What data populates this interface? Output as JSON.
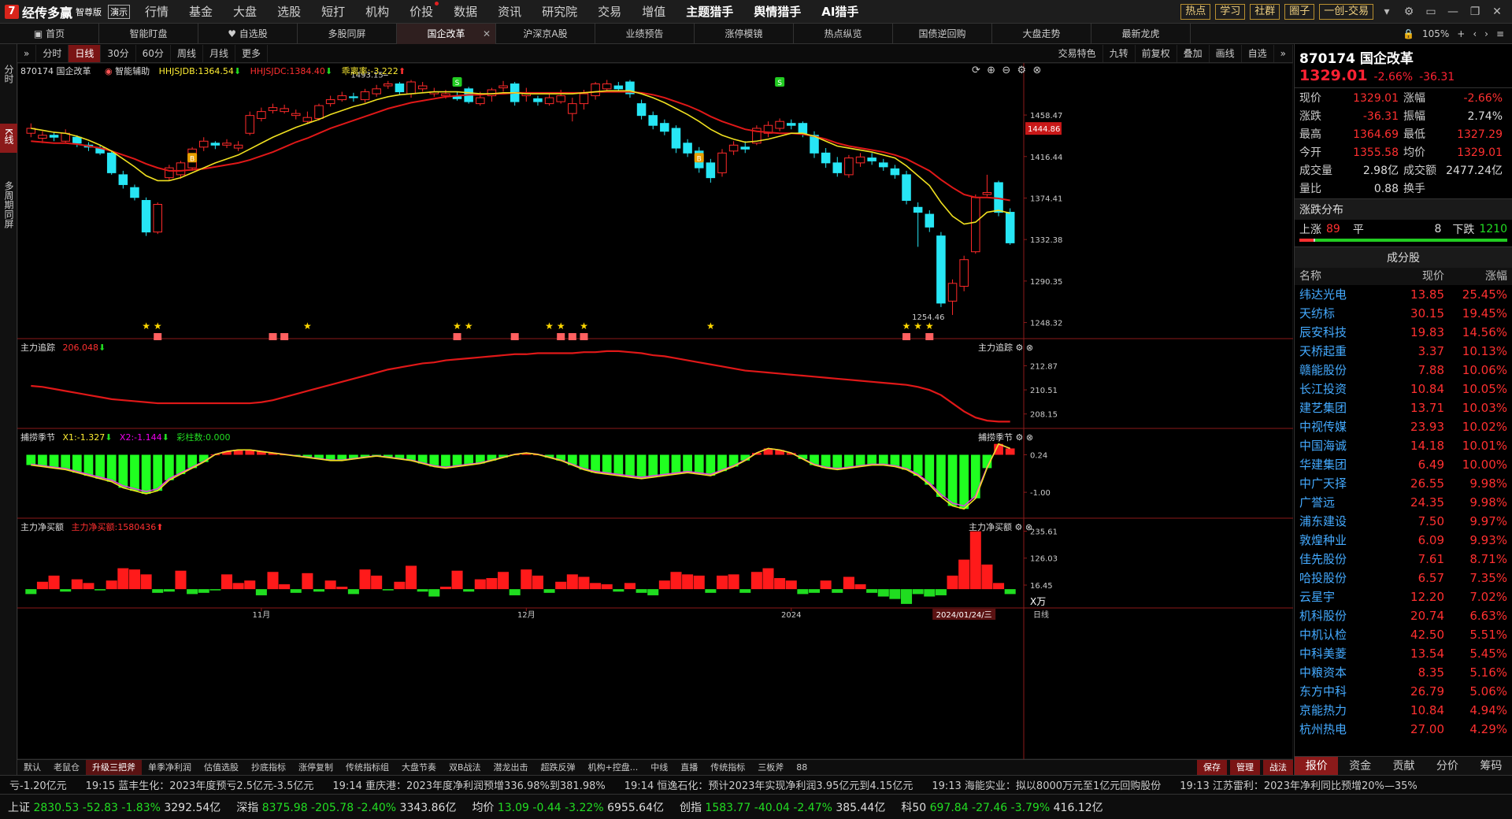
{
  "app": {
    "logo_mark": "7",
    "name": "经传多赢",
    "edition": "智尊版",
    "demo": "演示"
  },
  "menu": [
    "行情",
    "基金",
    "大盘",
    "选股",
    "短打",
    "机构",
    "价投",
    "数据",
    "资讯",
    "研究院",
    "交易",
    "增值",
    "主题猎手",
    "舆情猎手",
    "AI猎手"
  ],
  "menu_hot": [
    "主题猎手",
    "舆情猎手",
    "AI猎手"
  ],
  "menu_dot": [
    "价投"
  ],
  "top_buttons": [
    "热点",
    "学习",
    "社群",
    "圈子",
    "一创-交易"
  ],
  "tabs": [
    "首页",
    "智能盯盘",
    "自选股",
    "多股同屏",
    "国企改革",
    "沪深京A股",
    "业绩预告",
    "涨停模镜",
    "热点纵览",
    "国债逆回购",
    "大盘走势",
    "最新龙虎"
  ],
  "active_tab": "国企改革",
  "tabs_right": {
    "zoom": "105%"
  },
  "left_tabs": [
    "分时",
    "K线",
    "多周期同屏"
  ],
  "chart_bar": {
    "items": [
      "分时",
      "日线",
      "30分",
      "60分",
      "周线",
      "月线",
      "更多"
    ],
    "active": "日线",
    "right": [
      "交易特色",
      "九转",
      "前复权",
      "叠加",
      "画线",
      "自选"
    ]
  },
  "main_header": {
    "code_name": "870174 国企改革",
    "assist": "智能辅助",
    "hhjsjdb": "HHJSJDB:1364.54",
    "hhjsjdc": "HHJSJDC:1384.40",
    "ratio": "乖离率:-3.222"
  },
  "price_labels": [
    "1458.47",
    "1416.44",
    "1374.41",
    "1332.38",
    "1290.35",
    "1248.32"
  ],
  "current_price_tag": "1444.86",
  "high_label": "1493.15",
  "low_label": "1254.46",
  "panel2": {
    "title": "主力追踪",
    "value": "206.048",
    "right": "主力追踪",
    "labels": [
      "212.87",
      "210.51",
      "208.15"
    ]
  },
  "panel3": {
    "title": "捕捞季节",
    "x1": "X1:-1.327",
    "x2": "X2:-1.144",
    "bars": "彩柱数:0.000",
    "right": "捕捞季节",
    "labels": [
      "0.24",
      "-1.00"
    ]
  },
  "panel4": {
    "title": "主力净买额",
    "value": "主力净买额:1580436",
    "right": "主力净买额",
    "labels": [
      "235.61",
      "126.03",
      "16.45"
    ],
    "unit": "X万"
  },
  "date_axis": [
    "11月",
    "12月",
    "2024",
    "2024/01/24/三"
  ],
  "period_label": "日线",
  "bottom_tabs": [
    "默认",
    "老鼠仓",
    "升级三把斧",
    "单季净利润",
    "估值选股",
    "抄底指标",
    "涨停复制",
    "传统指标组",
    "大盘节奏",
    "双B战法",
    "潜龙出击",
    "超跌反弹",
    "机构+控盘...",
    "中线",
    "直播",
    "传统指标",
    "三板斧",
    "88"
  ],
  "bottom_active": "升级三把斧",
  "bottom_right": [
    "保存",
    "管理",
    "战法"
  ],
  "quote": {
    "code": "870174 国企改革",
    "price": "1329.01",
    "pct": "-2.66%",
    "chg": "-36.31",
    "rows": [
      [
        "现价",
        "1329.01",
        "涨幅",
        "-2.66%"
      ],
      [
        "涨跌",
        "-36.31",
        "振幅",
        "2.74%"
      ],
      [
        "最高",
        "1364.69",
        "最低",
        "1327.29"
      ],
      [
        "今开",
        "1355.58",
        "均价",
        "1329.01"
      ],
      [
        "成交量",
        "2.98亿",
        "成交额",
        "2477.24亿"
      ],
      [
        "量比",
        "0.88",
        "换手",
        ""
      ]
    ]
  },
  "dist": {
    "title": "涨跌分布",
    "up_label": "上涨",
    "up": "89",
    "flat_label": "平",
    "flat": "8",
    "down_label": "下跌",
    "down": "1210"
  },
  "constituents": {
    "title": "成分股",
    "headers": [
      "名称",
      "现价",
      "涨幅"
    ],
    "rows": [
      [
        "纬达光电",
        "13.85",
        "25.45%"
      ],
      [
        "天纺标",
        "30.15",
        "19.45%"
      ],
      [
        "辰安科技",
        "19.83",
        "14.56%"
      ],
      [
        "天桥起重",
        "3.37",
        "10.13%"
      ],
      [
        "赣能股份",
        "7.88",
        "10.06%"
      ],
      [
        "长江投资",
        "10.84",
        "10.05%"
      ],
      [
        "建艺集团",
        "13.71",
        "10.03%"
      ],
      [
        "中视传媒",
        "23.93",
        "10.02%"
      ],
      [
        "中国海诚",
        "14.18",
        "10.01%"
      ],
      [
        "华建集团",
        "6.49",
        "10.00%"
      ],
      [
        "中广天择",
        "26.55",
        "9.98%"
      ],
      [
        "广誉远",
        "24.35",
        "9.98%"
      ],
      [
        "浦东建设",
        "7.50",
        "9.97%"
      ],
      [
        "敦煌种业",
        "6.09",
        "9.93%"
      ],
      [
        "佳先股份",
        "7.61",
        "8.71%"
      ],
      [
        "哈投股份",
        "6.57",
        "7.35%"
      ],
      [
        "云星宇",
        "12.20",
        "7.02%"
      ],
      [
        "机科股份",
        "20.74",
        "6.63%"
      ],
      [
        "中机认检",
        "42.50",
        "5.51%"
      ],
      [
        "中科美菱",
        "13.54",
        "5.45%"
      ],
      [
        "中粮资本",
        "8.35",
        "5.16%"
      ],
      [
        "东方中科",
        "26.79",
        "5.06%"
      ],
      [
        "京能热力",
        "10.84",
        "4.94%"
      ],
      [
        "杭州热电",
        "27.00",
        "4.29%"
      ]
    ]
  },
  "rp_tabs": [
    "报价",
    "资金",
    "贡献",
    "分价",
    "筹码"
  ],
  "rp_active": "报价",
  "news": [
    "亏-1.20亿元",
    "19:15 蓝丰生化：2023年度预亏2.5亿元-3.5亿元",
    "19:14 重庆港：2023年度净利润预增336.98%到381.98%",
    "19:14 恒逸石化：预计2023年实现净利润3.95亿元到4.15亿元",
    "19:13 海能实业：拟以8000万元至1亿元回购股份",
    "19:13 江苏雷利：2023年净利同比预增20%—35%"
  ],
  "status": [
    {
      "name": "上证",
      "val": "2830.53",
      "chg": "-52.83",
      "pct": "-1.83%",
      "amt": "3292.54亿"
    },
    {
      "name": "深指",
      "val": "8375.98",
      "chg": "-205.78",
      "pct": "-2.40%",
      "amt": "3343.86亿"
    },
    {
      "name": "均价",
      "val": "13.09",
      "chg": "-0.44",
      "pct": "-3.22%",
      "amt": "6955.64亿"
    },
    {
      "name": "创指",
      "val": "1583.77",
      "chg": "-40.04",
      "pct": "-2.47%",
      "amt": "385.44亿"
    },
    {
      "name": "科50",
      "val": "697.84",
      "chg": "-27.46",
      "pct": "-3.79%",
      "amt": "416.12亿"
    }
  ],
  "candles": [
    [
      1440,
      1445,
      1450,
      1436
    ],
    [
      1435,
      1438,
      1442,
      1430
    ],
    [
      1438,
      1436,
      1441,
      1432
    ],
    [
      1432,
      1440,
      1444,
      1430
    ],
    [
      1436,
      1430,
      1438,
      1426
    ],
    [
      1428,
      1426,
      1431,
      1422
    ],
    [
      1425,
      1420,
      1428,
      1418
    ],
    [
      1420,
      1400,
      1422,
      1398
    ],
    [
      1398,
      1388,
      1402,
      1384
    ],
    [
      1385,
      1375,
      1388,
      1372
    ],
    [
      1372,
      1340,
      1375,
      1336
    ],
    [
      1340,
      1368,
      1370,
      1338
    ],
    [
      1395,
      1405,
      1408,
      1392
    ],
    [
      1398,
      1410,
      1412,
      1394
    ],
    [
      1405,
      1424,
      1426,
      1402
    ],
    [
      1426,
      1432,
      1436,
      1422
    ],
    [
      1430,
      1428,
      1432,
      1424
    ],
    [
      1428,
      1430,
      1434,
      1425
    ],
    [
      1425,
      1428,
      1432,
      1422
    ],
    [
      1440,
      1458,
      1462,
      1438
    ],
    [
      1455,
      1462,
      1466,
      1452
    ],
    [
      1463,
      1466,
      1470,
      1460
    ],
    [
      1462,
      1465,
      1469,
      1460
    ],
    [
      1458,
      1460,
      1464,
      1454
    ],
    [
      1452,
      1456,
      1462,
      1450
    ],
    [
      1455,
      1468,
      1470,
      1453
    ],
    [
      1470,
      1474,
      1478,
      1467
    ],
    [
      1474,
      1478,
      1482,
      1472
    ],
    [
      1477,
      1476,
      1481,
      1472
    ],
    [
      1474,
      1482,
      1485,
      1471
    ],
    [
      1480,
      1485,
      1489,
      1477
    ],
    [
      1488,
      1490,
      1493,
      1485
    ],
    [
      1490,
      1482,
      1492,
      1479
    ],
    [
      1480,
      1492,
      1494,
      1476
    ],
    [
      1485,
      1488,
      1492,
      1482
    ],
    [
      1480,
      1482,
      1486,
      1477
    ],
    [
      1478,
      1480,
      1484,
      1475
    ],
    [
      1477,
      1475,
      1482,
      1473
    ],
    [
      1485,
      1472,
      1487,
      1470
    ],
    [
      1470,
      1476,
      1482,
      1468
    ],
    [
      1478,
      1484,
      1486,
      1472
    ],
    [
      1486,
      1488,
      1493,
      1482
    ],
    [
      1490,
      1472,
      1492,
      1468
    ],
    [
      1478,
      1480,
      1486,
      1472
    ],
    [
      1475,
      1472,
      1478,
      1468
    ],
    [
      1470,
      1476,
      1480,
      1468
    ],
    [
      1472,
      1478,
      1484,
      1470
    ],
    [
      1460,
      1470,
      1476,
      1452
    ],
    [
      1470,
      1480,
      1484,
      1464
    ],
    [
      1478,
      1490,
      1492,
      1474
    ],
    [
      1485,
      1490,
      1494,
      1482
    ],
    [
      1488,
      1485,
      1492,
      1482
    ],
    [
      1492,
      1480,
      1494,
      1476
    ],
    [
      1470,
      1458,
      1474,
      1454
    ],
    [
      1458,
      1448,
      1462,
      1444
    ],
    [
      1450,
      1442,
      1454,
      1438
    ],
    [
      1445,
      1425,
      1448,
      1420
    ],
    [
      1430,
      1420,
      1434,
      1416
    ],
    [
      1422,
      1405,
      1426,
      1400
    ],
    [
      1410,
      1395,
      1414,
      1390
    ],
    [
      1400,
      1420,
      1424,
      1396
    ],
    [
      1422,
      1428,
      1432,
      1418
    ],
    [
      1426,
      1424,
      1432,
      1420
    ],
    [
      1430,
      1445,
      1448,
      1428
    ],
    [
      1440,
      1448,
      1452,
      1436
    ],
    [
      1445,
      1452,
      1455,
      1442
    ],
    [
      1450,
      1448,
      1454,
      1444
    ],
    [
      1450,
      1440,
      1452,
      1436
    ],
    [
      1438,
      1420,
      1442,
      1415
    ],
    [
      1420,
      1410,
      1425,
      1405
    ],
    [
      1410,
      1400,
      1416,
      1396
    ],
    [
      1398,
      1415,
      1418,
      1395
    ],
    [
      1410,
      1416,
      1420,
      1406
    ],
    [
      1415,
      1412,
      1420,
      1408
    ],
    [
      1410,
      1406,
      1414,
      1402
    ],
    [
      1404,
      1398,
      1408,
      1394
    ],
    [
      1398,
      1372,
      1402,
      1368
    ],
    [
      1365,
      1360,
      1370,
      1325
    ],
    [
      1358,
      1345,
      1362,
      1340
    ],
    [
      1336,
      1268,
      1340,
      1264
    ],
    [
      1270,
      1288,
      1292,
      1256
    ],
    [
      1285,
      1312,
      1316,
      1280
    ],
    [
      1320,
      1375,
      1378,
      1318
    ],
    [
      1378,
      1380,
      1398,
      1376
    ],
    [
      1390,
      1360,
      1392,
      1356
    ],
    [
      1360,
      1329,
      1364,
      1327
    ]
  ],
  "ma_yellow": [
    1445,
    1443,
    1441,
    1440,
    1437,
    1433,
    1428,
    1422,
    1414,
    1406,
    1397,
    1392,
    1392,
    1395,
    1400,
    1405,
    1410,
    1414,
    1418,
    1424,
    1430,
    1436,
    1441,
    1446,
    1450,
    1454,
    1459,
    1463,
    1467,
    1470,
    1474,
    1477,
    1479,
    1480,
    1481,
    1482,
    1482,
    1482,
    1481,
    1480,
    1480,
    1481,
    1481,
    1480,
    1480,
    1480,
    1480,
    1480,
    1481,
    1482,
    1483,
    1483,
    1483,
    1480,
    1476,
    1471,
    1465,
    1459,
    1452,
    1444,
    1438,
    1434,
    1431,
    1432,
    1434,
    1437,
    1440,
    1440,
    1437,
    1432,
    1427,
    1425,
    1423,
    1421,
    1418,
    1415,
    1407,
    1397,
    1387,
    1370,
    1356,
    1348,
    1350,
    1360,
    1362,
    1359
  ],
  "ma_red": [
    1432,
    1431,
    1430,
    1430,
    1429,
    1427,
    1425,
    1422,
    1418,
    1414,
    1409,
    1405,
    1402,
    1402,
    1403,
    1404,
    1406,
    1408,
    1410,
    1413,
    1417,
    1421,
    1426,
    1431,
    1435,
    1440,
    1445,
    1449,
    1453,
    1457,
    1461,
    1465,
    1468,
    1471,
    1473,
    1475,
    1477,
    1478,
    1479,
    1479,
    1480,
    1480,
    1481,
    1481,
    1481,
    1481,
    1481,
    1481,
    1481,
    1482,
    1482,
    1482,
    1482,
    1481,
    1479,
    1476,
    1472,
    1468,
    1463,
    1457,
    1452,
    1448,
    1444,
    1442,
    1441,
    1440,
    1440,
    1439,
    1437,
    1434,
    1430,
    1427,
    1425,
    1423,
    1421,
    1418,
    1414,
    1408,
    1402,
    1393,
    1385,
    1378,
    1375,
    1375,
    1374,
    1372
  ],
  "tracking": [
    210.9,
    210.8,
    210.6,
    210.4,
    210.2,
    210.0,
    209.8,
    209.6,
    209.5,
    209.4,
    209.3,
    209.2,
    209.2,
    209.2,
    209.2,
    209.2,
    209.2,
    209.2,
    209.2,
    209.2,
    209.3,
    209.5,
    209.8,
    210.1,
    210.4,
    210.7,
    211.0,
    211.3,
    211.6,
    211.9,
    212.2,
    212.5,
    212.7,
    212.9,
    213.1,
    213.2,
    213.4,
    213.5,
    213.6,
    213.7,
    213.8,
    213.9,
    214.0,
    214.0,
    214.1,
    214.1,
    214.1,
    214.1,
    214.2,
    214.2,
    214.3,
    214.3,
    214.2,
    214.1,
    213.9,
    213.8,
    213.6,
    213.4,
    213.2,
    213.0,
    212.8,
    212.6,
    212.4,
    212.3,
    212.2,
    212.1,
    212.0,
    211.9,
    211.8,
    211.7,
    211.6,
    211.5,
    211.4,
    211.3,
    211.2,
    211.1,
    211.0,
    210.8,
    210.5,
    210.0,
    209.2,
    208.4,
    207.8,
    207.5,
    207.4,
    207.4
  ],
  "oscillator": [
    -0.1,
    -0.15,
    -0.2,
    -0.25,
    -0.35,
    -0.45,
    -0.55,
    -0.65,
    -0.85,
    -0.95,
    -1.05,
    -0.95,
    -0.6,
    -0.4,
    -0.2,
    0.0,
    0.25,
    0.35,
    0.4,
    0.4,
    0.35,
    0.3,
    0.25,
    0.2,
    0.15,
    0.1,
    0.05,
    0.05,
    0.1,
    0.15,
    0.2,
    0.15,
    0.1,
    0.05,
    -0.05,
    -0.15,
    -0.2,
    -0.15,
    -0.1,
    -0.05,
    0.05,
    0.15,
    0.25,
    0.3,
    0.25,
    0.15,
    0.05,
    -0.1,
    -0.25,
    -0.35,
    -0.4,
    -0.45,
    -0.5,
    -0.55,
    -0.5,
    -0.45,
    -0.4,
    -0.35,
    -0.4,
    -0.45,
    -0.3,
    -0.15,
    0.05,
    0.3,
    0.45,
    0.4,
    0.3,
    0.1,
    -0.1,
    -0.2,
    -0.25,
    -0.2,
    -0.15,
    -0.1,
    -0.1,
    -0.15,
    -0.25,
    -0.45,
    -0.75,
    -1.15,
    -1.45,
    -1.55,
    -1.2,
    -0.2,
    0.6,
    0.45
  ],
  "netbuy": [
    -20,
    30,
    55,
    -10,
    40,
    25,
    -5,
    35,
    85,
    80,
    60,
    -15,
    -10,
    75,
    -20,
    -15,
    -5,
    60,
    25,
    35,
    -25,
    70,
    20,
    -15,
    65,
    -10,
    35,
    10,
    -20,
    80,
    55,
    -5,
    30,
    95,
    -10,
    -30,
    10,
    75,
    -10,
    40,
    45,
    70,
    -25,
    80,
    55,
    -15,
    30,
    60,
    50,
    25,
    20,
    -10,
    25,
    -15,
    -25,
    35,
    70,
    60,
    55,
    -15,
    55,
    60,
    -15,
    70,
    85,
    45,
    35,
    -20,
    -15,
    35,
    -15,
    50,
    20,
    -15,
    -30,
    -40,
    -60,
    -20,
    -30,
    -25,
    55,
    120,
    235,
    100,
    25,
    -20
  ]
}
